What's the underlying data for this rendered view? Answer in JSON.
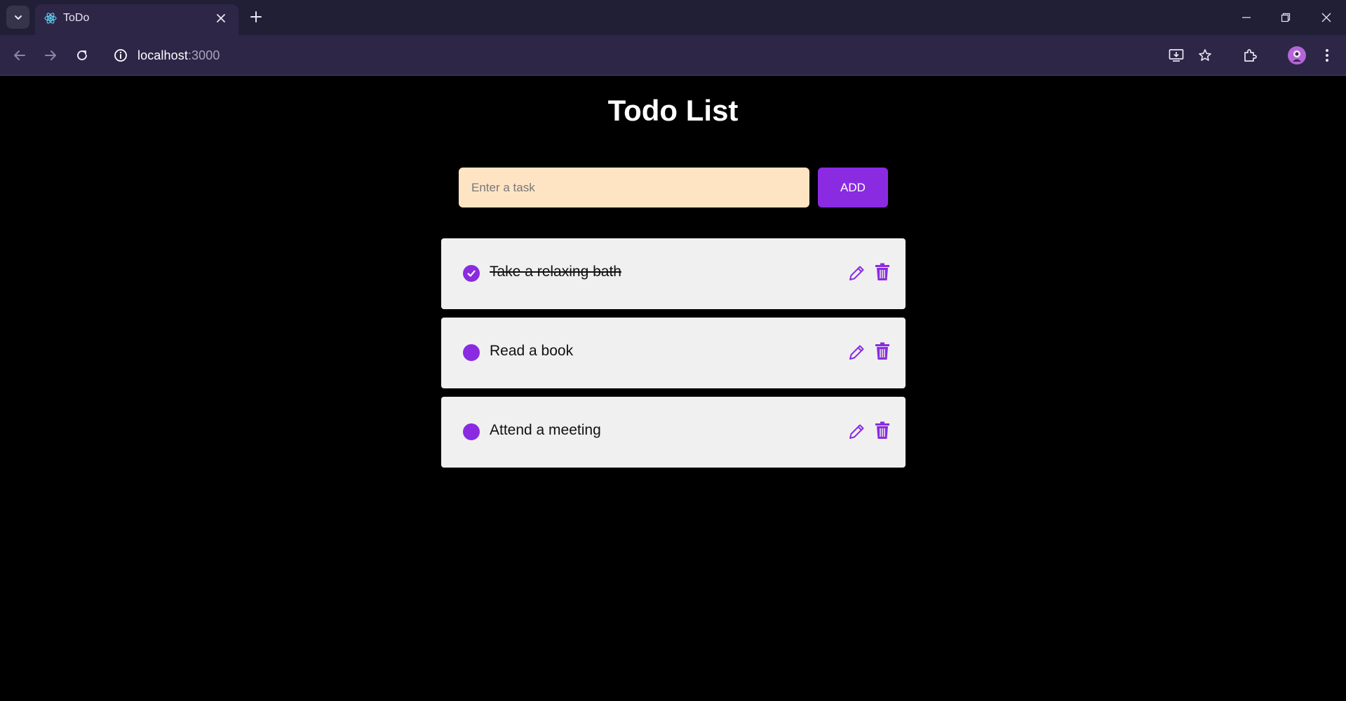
{
  "browser": {
    "tab_title": "ToDo",
    "url_host": "localhost",
    "url_port": ":3000"
  },
  "app": {
    "title": "Todo List",
    "input_placeholder": "Enter a task",
    "input_value": "",
    "add_label": "ADD",
    "accent_color": "#8a2be2",
    "input_bg_color": "#ffe4c4",
    "todos": [
      {
        "text": "Take a relaxing bath",
        "completed": true
      },
      {
        "text": "Read a book",
        "completed": false
      },
      {
        "text": "Attend a meeting",
        "completed": false
      }
    ]
  },
  "icons": {
    "tab_search": "chevron-down-icon",
    "favicon": "react-icon",
    "close": "close-icon",
    "new_tab": "plus-icon",
    "edit": "pencil-icon",
    "delete": "trash-icon",
    "check": "check-icon"
  }
}
